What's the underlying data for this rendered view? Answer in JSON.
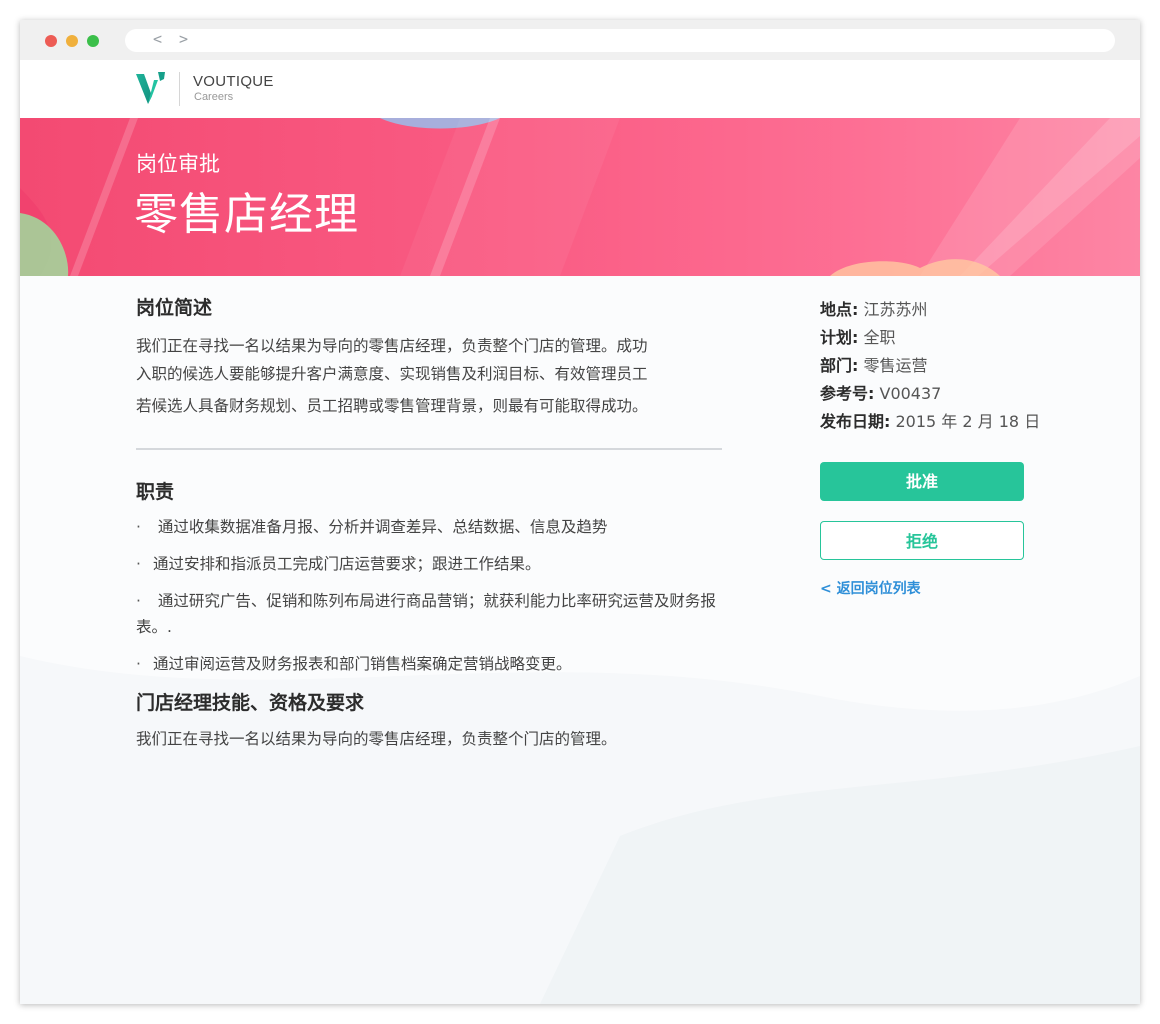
{
  "browser": {
    "nav": "< >"
  },
  "brand": {
    "name": "VOUTIQUE",
    "sub": "Careers"
  },
  "hero": {
    "subtitle": "岗位审批",
    "title": "零售店经理"
  },
  "summary": {
    "heading": "岗位简述",
    "lines": [
      "我们正在寻找一名以结果为导向的零售店经理，负责整个门店的管理。成功",
      "入职的候选人要能够提升客户满意度、实现销售及利润目标、有效管理员工",
      "若候选人具备财务规划、员工招聘或零售管理背景，则最有可能取得成功。"
    ]
  },
  "responsibilities": {
    "heading": "职责",
    "bullet": "·",
    "items": [
      "  通过收集数据准备月报、分析并调查差异、总结数据、信息及趋势",
      "通过安排和指派员工完成门店运营要求；跟进工作结果。",
      " 通过研究广告、促销和陈列布局进行商品营销；就获利能力比率研究运营及财务报表。.",
      "通过审阅运营及财务报表和部门销售档案确定营销战略变更。"
    ]
  },
  "skills": {
    "heading": "门店经理技能、资格及要求",
    "text": "我们正在寻找一名以结果为导向的零售店经理，负责整个门店的管理。"
  },
  "meta": [
    {
      "label": "地点:",
      "value": "江苏苏州"
    },
    {
      "label": "计划:",
      "value": "全职"
    },
    {
      "label": "部门:",
      "value": "零售运营"
    },
    {
      "label": "参考号:",
      "value": "V00437"
    },
    {
      "label": "发布日期:",
      "value": "2015 年 2 月 18 日"
    }
  ],
  "actions": {
    "approve": "批准",
    "reject": "拒绝",
    "back": "< 返回岗位列表"
  },
  "colors": {
    "accent": "#27c59a",
    "hero": "#f84d77",
    "link": "#2f8fd8"
  }
}
